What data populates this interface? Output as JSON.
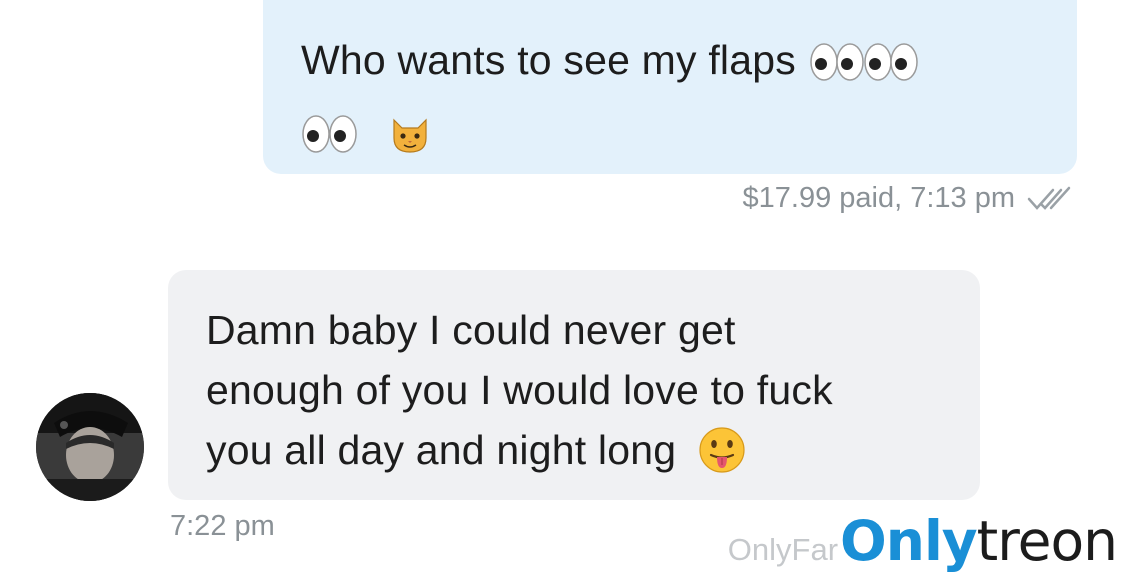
{
  "messages": {
    "outgoing": {
      "text": "Who wants to see my flaps",
      "meta": "$17.99 paid, 7:13 pm",
      "emojis": [
        "eyes",
        "eyes",
        "eyes",
        "cat-face"
      ]
    },
    "incoming": {
      "line1": "Damn baby I could never get",
      "line2": "enough of you I would love to fuck",
      "line3": "you all day and night long",
      "meta": "7:22 pm",
      "emojis": [
        "face-with-tongue"
      ]
    }
  },
  "watermark": {
    "prefix": "OnlyFar",
    "brand_a": "Only",
    "brand_b": "treon"
  },
  "colors": {
    "outgoing_bubble": "#e3f1fb",
    "incoming_bubble": "#f0f1f3",
    "meta_text": "#8a9196",
    "brand_blue": "#1a8fd6"
  }
}
